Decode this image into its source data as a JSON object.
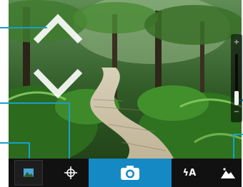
{
  "toolbar": {
    "flash_label": "ϟA",
    "shutter_icon": "camera-icon",
    "focus_icon": "crosshair-icon",
    "scene_icon": "mountain-scene-icon",
    "thumbnail_icon": "photo-thumbnail-icon"
  },
  "zoom": {
    "plus_label": "+",
    "minus_label": "−",
    "level": 0.2
  },
  "colors": {
    "accent": "#1589c4",
    "callout": "#1aa0c8",
    "toolbar": "#111111"
  }
}
